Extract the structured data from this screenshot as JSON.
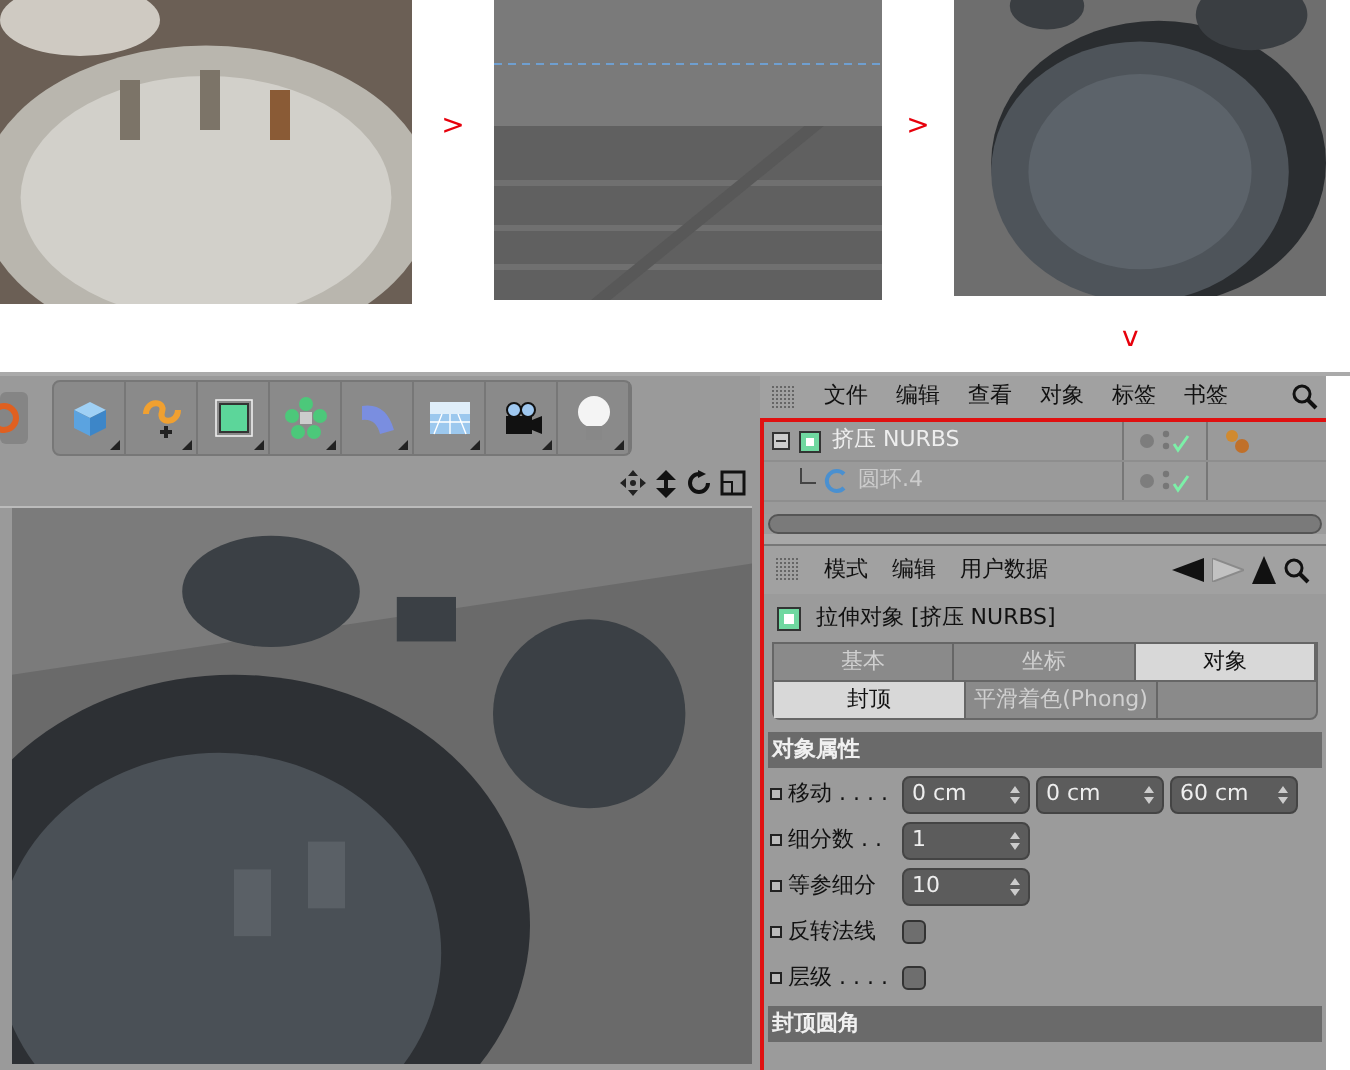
{
  "steps": [
    {
      "arrow": ">"
    },
    {
      "arrow": ">"
    },
    {
      "arrow": "v"
    }
  ],
  "object_manager": {
    "menu": [
      "文件",
      "编辑",
      "查看",
      "对象",
      "标签",
      "书签"
    ],
    "tree": [
      {
        "name": "挤压 NURBS",
        "expanded": true,
        "children": [
          {
            "name": "圆环.4"
          }
        ]
      }
    ]
  },
  "attributes": {
    "menu": [
      "模式",
      "编辑",
      "用户数据"
    ],
    "title": "拉伸对象 [挤压 NURBS]",
    "tabs": [
      {
        "label": "基本",
        "selected": false
      },
      {
        "label": "坐标",
        "selected": false
      },
      {
        "label": "对象",
        "selected": true
      }
    ],
    "subtabs": [
      {
        "label": "封顶",
        "selected": true
      },
      {
        "label": "平滑着色(Phong)",
        "selected": false
      }
    ],
    "section": "对象属性",
    "fields": [
      {
        "kind": "vector",
        "label": "移动 . . . .",
        "values": [
          "0 cm",
          "0 cm",
          "60 cm"
        ]
      },
      {
        "kind": "number",
        "label": "细分数 . .",
        "values": [
          "1"
        ]
      },
      {
        "kind": "number",
        "label": "等参细分",
        "values": [
          "10"
        ]
      },
      {
        "kind": "checkbox",
        "label": "反转法线",
        "checked": false
      },
      {
        "kind": "checkbox",
        "label": "层级 . . . .",
        "checked": false
      }
    ],
    "next_section": "封顶圆角"
  }
}
